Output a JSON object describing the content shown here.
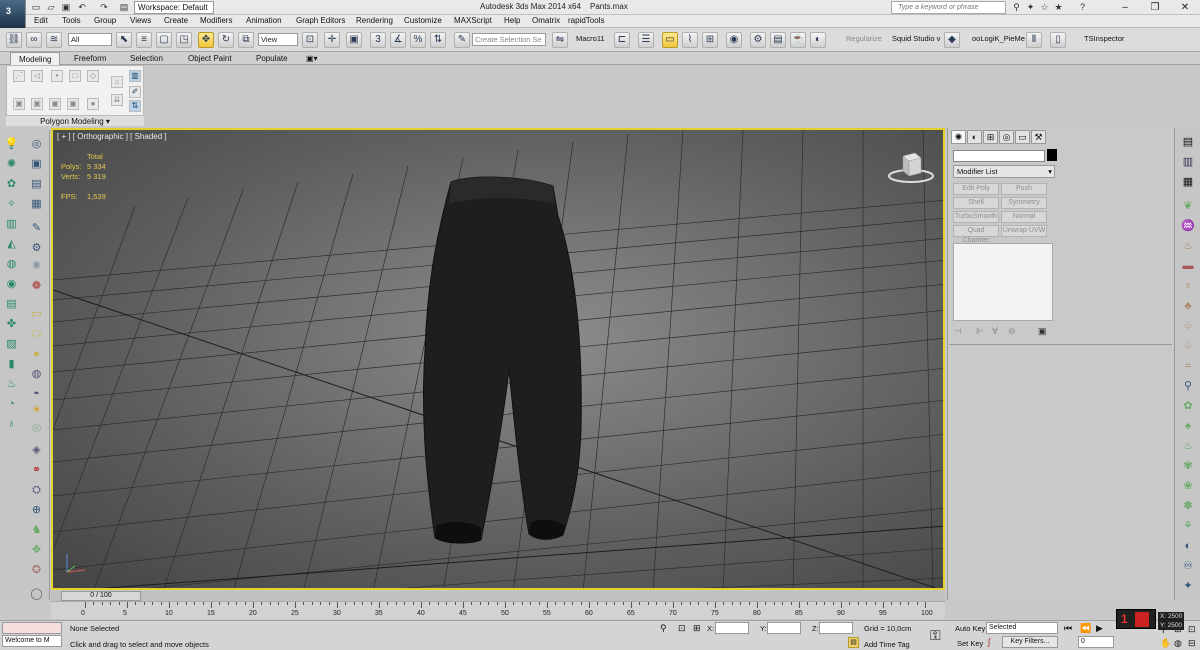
{
  "titlebar": {
    "app_button": "3",
    "workspace": "Workspace: Default",
    "app_title": "Autodesk 3ds Max  2014 x64",
    "doc_name": "Pants.max",
    "search_placeholder": "Type a keyword or phrase"
  },
  "menu": [
    "Edit",
    "Tools",
    "Group",
    "Views",
    "Create",
    "Modifiers",
    "Animation",
    "Graph Editors",
    "Rendering",
    "Customize",
    "MAXScript",
    "Help",
    "Omatrix",
    "rapidTools"
  ],
  "toolbar": {
    "filter": "All",
    "ref_coord": "View",
    "selection_set": "Create Selection Se",
    "macro": "Macro11",
    "regularize": "Regularize",
    "squid": "Squid Studio v",
    "pielogik": "ooLogiK_PieMe",
    "tsinspector": "TSInspector"
  },
  "ribbon": {
    "tabs": [
      "Modeling",
      "Freeform",
      "Selection",
      "Object Paint",
      "Populate"
    ],
    "panel_label": "Polygon Modeling"
  },
  "viewport": {
    "label": "[ + ] [ Orthographic ] [ Shaded ]",
    "stats_total": "Total",
    "polys_label": "Polys:",
    "polys_value": "5 334",
    "verts_label": "Verts:",
    "verts_value": "5 319",
    "fps_label": "FPS:",
    "fps_value": "1,539"
  },
  "command_panel": {
    "modifier_list": "Modifier List",
    "buttons": [
      "Edit Poly",
      "Push",
      "Shell",
      "Symmetry",
      "TurboSmooth",
      "Normal",
      "Quad Chamfer",
      "Unwrap UVW"
    ]
  },
  "timeline": {
    "slider": "0 / 100",
    "ticks": [
      "0",
      "5",
      "10",
      "15",
      "20",
      "25",
      "30",
      "35",
      "40",
      "45",
      "50",
      "55",
      "60",
      "65",
      "70",
      "75",
      "80",
      "85",
      "90",
      "95",
      "100"
    ]
  },
  "status": {
    "maxscript_listener": "Welcome to M",
    "selection": "None Selected",
    "prompt": "Click and drag to select and move objects",
    "x_label": "X:",
    "y_label": "Y:",
    "z_label": "Z:",
    "grid": "Grid = 10,0cm",
    "add_time_tag": "Add Time Tag",
    "auto_key": "Auto Key",
    "set_key": "Set Key",
    "key_mode": "Selected",
    "key_filters": "Key Filters...",
    "frame": "0",
    "coord_x": "X: 2500",
    "coord_y": "Y: 2500"
  }
}
